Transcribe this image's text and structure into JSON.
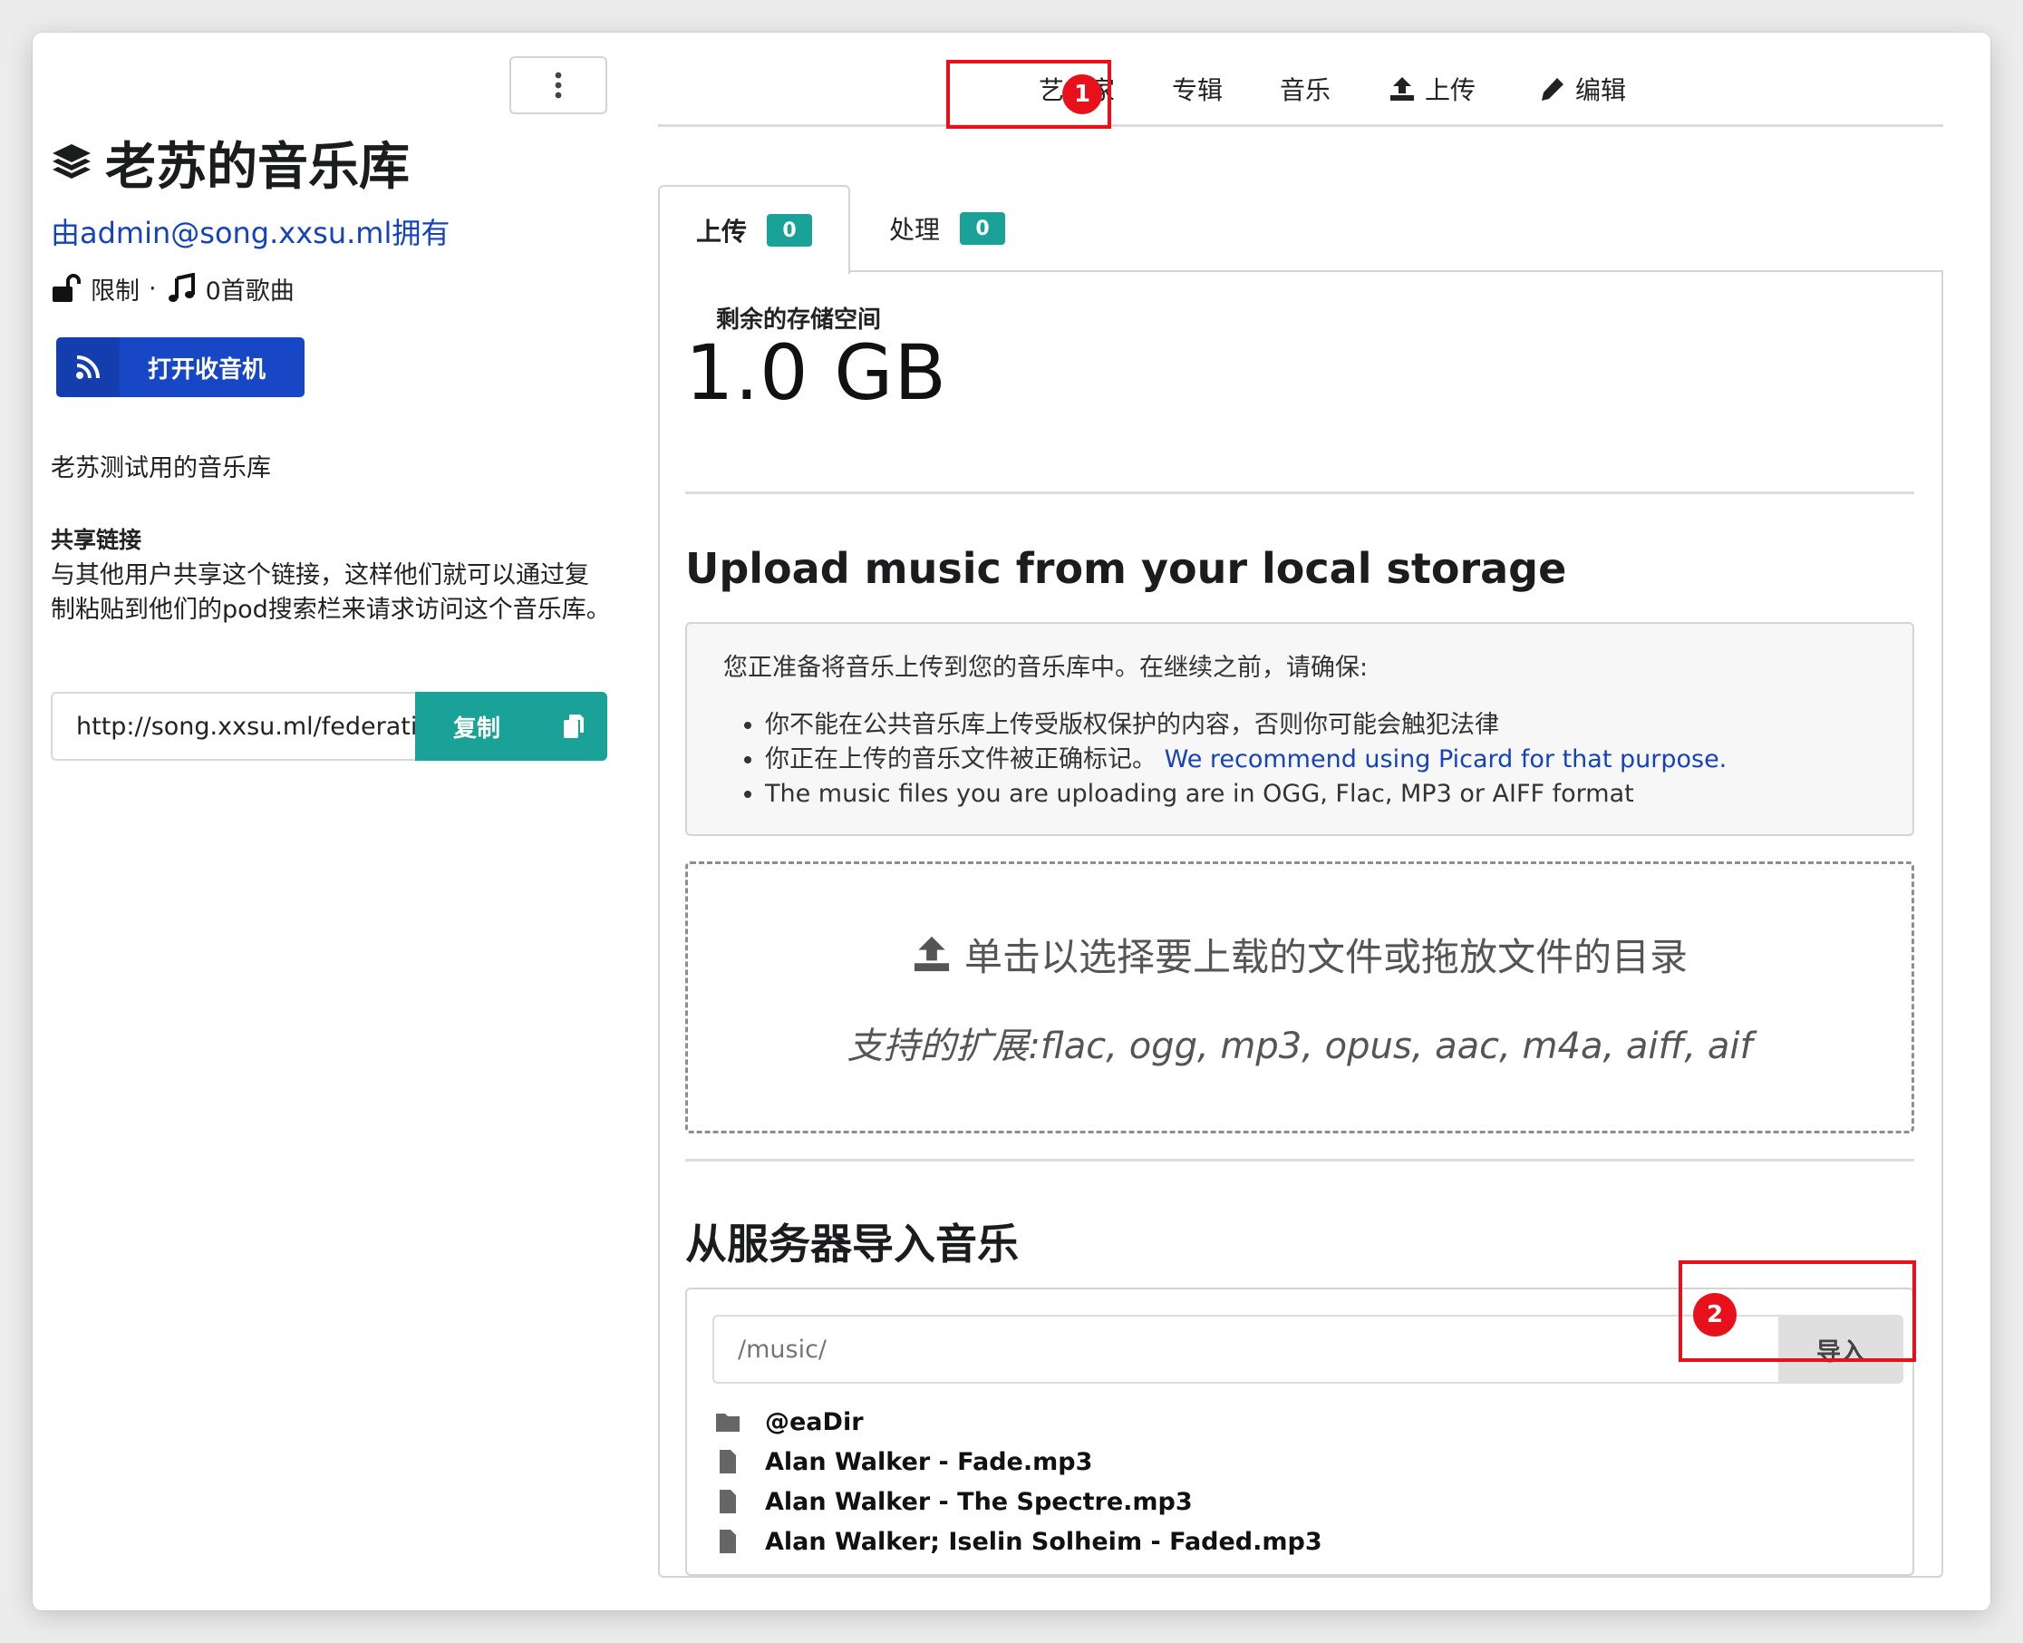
{
  "sidebar": {
    "menu_icon": "ellipsis-vertical-icon",
    "library_icon": "layer-group-icon",
    "title": "老苏的音乐库",
    "owner": "由admin@song.xxsu.ml拥有",
    "privacy": "限制",
    "separator": "·",
    "track_count": "0首歌曲",
    "radio_button": "打开收音机",
    "description": "老苏测试用的音乐库",
    "share_title": "共享链接",
    "share_text": "与其他用户共享这个链接，这样他们就可以通过复制粘贴到他们的pod搜索栏来请求访问这个音乐库。",
    "share_url": "http://song.xxsu.ml/federation/music/libraries/",
    "copy_button": "复制"
  },
  "topmenu": {
    "items": [
      {
        "label": "艺术家"
      },
      {
        "label": "专辑"
      },
      {
        "label": "音乐"
      },
      {
        "label": "上传",
        "icon": "upload-icon"
      },
      {
        "label": "编辑",
        "icon": "pencil-icon"
      }
    ]
  },
  "annotations": {
    "badge1": "1",
    "badge2": "2",
    "color": "#e8101b"
  },
  "tabs": [
    {
      "label": "上传",
      "count": "0"
    },
    {
      "label": "处理",
      "count": "0"
    }
  ],
  "storage": {
    "label": "剩余的存储空间",
    "value": "1.0 GB"
  },
  "upload_section": {
    "title": "Upload music from your local storage",
    "notice_intro": "您正准备将音乐上传到您的音乐库中。在继续之前，请确保:",
    "bullets": [
      "你不能在公共音乐库上传受版权保护的内容，否则你可能会触犯法律",
      "你正在上传的音乐文件被正确标记。",
      "The music files you are uploading are in OGG, Flac, MP3 or AIFF format"
    ],
    "picard_link": "We recommend using Picard for that purpose.",
    "dropzone_text": "单击以选择要上载的文件或拖放文件的目录",
    "dropzone_ext": "支持的扩展:flac, ogg, mp3, opus, aac, m4a, aiff, aif"
  },
  "import_section": {
    "title": "从服务器导入音乐",
    "path_placeholder": "/music/",
    "import_button": "导入",
    "files": [
      {
        "name": "@eaDir",
        "type": "folder"
      },
      {
        "name": "Alan Walker - Fade.mp3",
        "type": "file"
      },
      {
        "name": "Alan Walker - The Spectre.mp3",
        "type": "file"
      },
      {
        "name": "Alan Walker; Iselin Solheim - Faded.mp3",
        "type": "file"
      }
    ]
  },
  "colors": {
    "primary": "#1747c5",
    "teal": "#1aa198",
    "link": "#1543bc"
  }
}
